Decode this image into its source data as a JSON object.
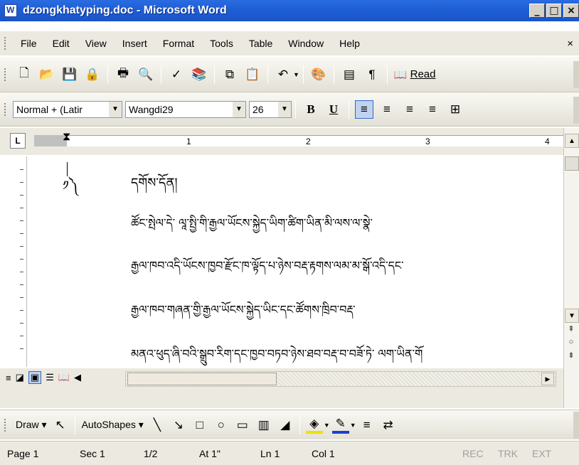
{
  "window": {
    "title": "dzongkhatyping.doc - Microsoft Word",
    "min": "_",
    "max": "□",
    "close": "×"
  },
  "menu": [
    "File",
    "Edit",
    "View",
    "Insert",
    "Format",
    "Tools",
    "Table",
    "Window",
    "Help"
  ],
  "menu_close": "×",
  "standard_toolbar": {
    "read_label": "Read"
  },
  "formatting_toolbar": {
    "style": "Normal + (Latir",
    "font": "Wangdi29",
    "size": "26",
    "bold": "B",
    "underline": "U"
  },
  "ruler": {
    "corner": "L",
    "numbers": [
      "1",
      "2",
      "3",
      "4"
    ]
  },
  "document": {
    "lines": [
      {
        "num": "༡༽",
        "text": "དགོས་དོན།"
      },
      {
        "num": "",
        "text": "ཚོང་སྤེལ་དེ་        ལཱ་སྤྱི་གི་རྒྱལ་ཡོངས་སྐྱེད་ཡིག་ཚིག་ཡིན་མི་ལས་ལ་སྣེ་"
      },
      {
        "num": "",
        "text": "རྒྱལ་ཁབ་འདི་ཡོངས་ཁྱབ་རྫོང་ཁ་ལྟོད་པ་ཉེས་བརྡ་རྟགས་ལམ་མ་སྒོ་འདི་དང་"
      },
      {
        "num": "",
        "text": "རྒྱལ་ཁབ་གཞན་གྱི་རྒྱལ་ཡོངས་སྐྱེད་ཡིང་དང་ཚོགས་ཁྲིབ་བརྡ་"
      },
      {
        "num": "",
        "text": "མནའ་ཕུད་ཞི་བའི་སྒྲུབ་རིག་དང་ཁྱབ་བཏབ་ཉེས་ཐབ་བརྡ་བ་བཟོ་ཏེ་    ལག་ཡིན་གོ"
      }
    ]
  },
  "drawing_toolbar": {
    "draw": "Draw",
    "autoshapes": "AutoShapes"
  },
  "status": {
    "page": "Page 1",
    "sec": "Sec 1",
    "pages": "1/2",
    "at": "At 1\"",
    "ln": "Ln 1",
    "col": "Col 1",
    "rec": "REC",
    "trk": "TRK",
    "ext": "EXT"
  }
}
